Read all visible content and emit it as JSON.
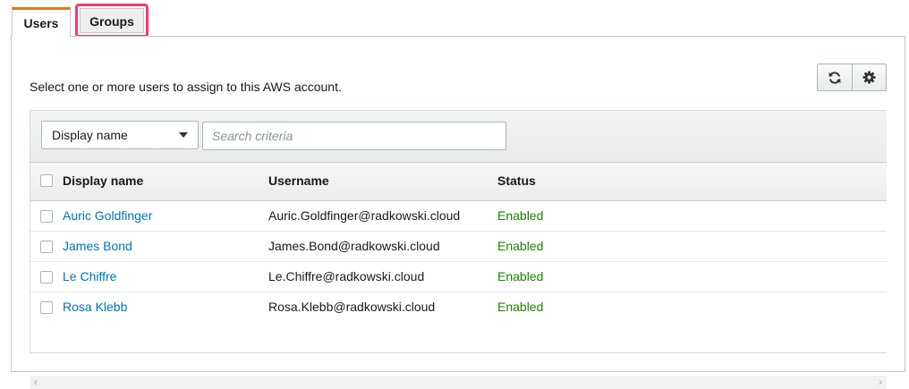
{
  "tabs": [
    {
      "label": "Users",
      "active": true
    },
    {
      "label": "Groups",
      "active": false,
      "highlighted": true
    }
  ],
  "instruction": "Select one or more users to assign to this AWS account.",
  "toolbar": {
    "refresh_icon": "refresh-icon",
    "settings_icon": "gear-icon"
  },
  "filter": {
    "selected": "Display name",
    "search_placeholder": "Search criteria",
    "search_value": ""
  },
  "table": {
    "columns": [
      "Display name",
      "Username",
      "Status"
    ],
    "rows": [
      {
        "display_name": "Auric Goldfinger",
        "username": "Auric.Goldfinger@radkowski.cloud",
        "status": "Enabled"
      },
      {
        "display_name": "James Bond",
        "username": "James.Bond@radkowski.cloud",
        "status": "Enabled"
      },
      {
        "display_name": "Le Chiffre",
        "username": "Le.Chiffre@radkowski.cloud",
        "status": "Enabled"
      },
      {
        "display_name": "Rosa Klebb",
        "username": "Rosa.Klebb@radkowski.cloud",
        "status": "Enabled"
      }
    ]
  },
  "colors": {
    "accent_tab": "#e07b12",
    "highlight": "#ef3c6f",
    "link": "#0073bb",
    "status_enabled": "#1d8102"
  }
}
